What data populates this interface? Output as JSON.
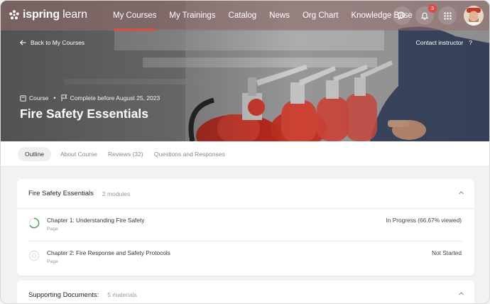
{
  "nav": {
    "logo_brand": "ispring",
    "logo_product": " learn",
    "items": [
      {
        "label": "My Courses",
        "active": true
      },
      {
        "label": "My Trainings",
        "active": false
      },
      {
        "label": "Catalog",
        "active": false
      },
      {
        "label": "News",
        "active": false
      },
      {
        "label": "Org Chart",
        "active": false
      },
      {
        "label": "Knowledge Base",
        "active": false
      }
    ],
    "notification_count": "3"
  },
  "hero": {
    "back_label": "Back to My Courses",
    "contact_label": "Contact instructor",
    "help_glyph": "?",
    "type_label": "Course",
    "dot": "•",
    "deadline_label": "Complete before August 25, 2023",
    "title": "Fire Safety Essentials"
  },
  "tabs": [
    {
      "label": "Outline",
      "active": true
    },
    {
      "label": "About Course",
      "active": false
    },
    {
      "label": "Reviews (32)",
      "active": false
    },
    {
      "label": "Questions and Responses",
      "active": false
    }
  ],
  "modules_card": {
    "title": "Fire Safety Essentials",
    "count": "2 modules",
    "rows": [
      {
        "title": "Chapter 1: Understanding Fire Safety",
        "type": "Page",
        "status": "In Progress (66.67% viewed)",
        "progress": 0.6667
      },
      {
        "title": "Chapter 2: Fire Response and Safety Protocols",
        "type": "Page",
        "status": "Not Started",
        "progress": 0
      }
    ]
  },
  "documents_card": {
    "title": "Supporting Documents:",
    "count": "5 materials"
  },
  "colors": {
    "accent": "#e04a3f",
    "progress_ring": "#3aa05a"
  }
}
